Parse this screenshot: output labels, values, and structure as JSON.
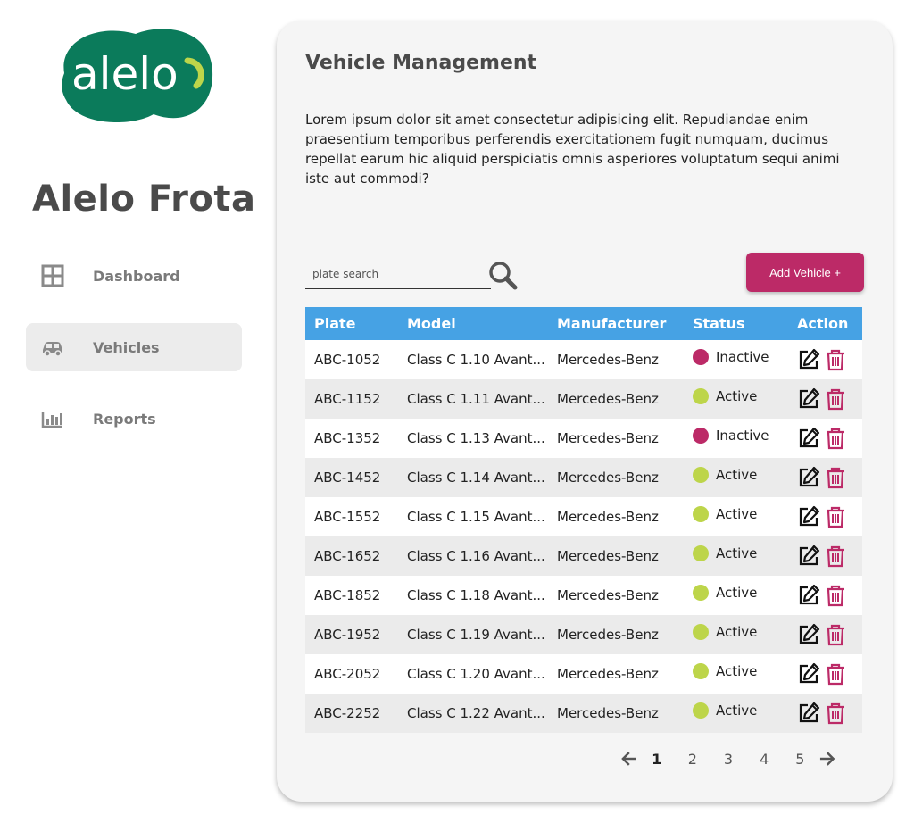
{
  "brand": {
    "logo_text": "alelo",
    "logo_color": "#0b7b5b",
    "logo_accent": "#bdd54a",
    "title": "Alelo Frota"
  },
  "nav": {
    "items": [
      {
        "label": "Dashboard",
        "icon": "grid-icon",
        "active": false
      },
      {
        "label": "Vehicles",
        "icon": "car-icon",
        "active": true
      },
      {
        "label": "Reports",
        "icon": "bar-chart-icon",
        "active": false
      }
    ]
  },
  "main": {
    "title": "Vehicle Management",
    "description": "Lorem ipsum dolor sit amet consectetur adipisicing elit. Repudiandae enim praesentium temporibus perferendis exercitationem fugit numquam, ducimus repellat earum hic aliquid perspiciatis omnis asperiores voluptatum sequi animi iste aut commodi?",
    "search": {
      "placeholder": "plate search",
      "value": "",
      "icon": "search-icon"
    },
    "add_button_label": "Add Vehicle +"
  },
  "table": {
    "columns": [
      "Plate",
      "Model",
      "Manufacturer",
      "Status",
      "Action"
    ],
    "rows": [
      {
        "plate": "ABC-1052",
        "model": "Class C 1.10 Avant...",
        "manufacturer": "Mercedes-Benz",
        "status": "Inactive"
      },
      {
        "plate": "ABC-1152",
        "model": "Class C 1.11 Avant...",
        "manufacturer": "Mercedes-Benz",
        "status": "Active"
      },
      {
        "plate": "ABC-1352",
        "model": "Class C 1.13 Avant...",
        "manufacturer": "Mercedes-Benz",
        "status": "Inactive"
      },
      {
        "plate": "ABC-1452",
        "model": "Class C 1.14 Avant...",
        "manufacturer": "Mercedes-Benz",
        "status": "Active"
      },
      {
        "plate": "ABC-1552",
        "model": "Class C 1.15 Avant...",
        "manufacturer": "Mercedes-Benz",
        "status": "Active"
      },
      {
        "plate": "ABC-1652",
        "model": "Class C 1.16 Avant...",
        "manufacturer": "Mercedes-Benz",
        "status": "Active"
      },
      {
        "plate": "ABC-1852",
        "model": "Class C 1.18 Avant...",
        "manufacturer": "Mercedes-Benz",
        "status": "Active"
      },
      {
        "plate": "ABC-1952",
        "model": "Class C 1.19 Avant...",
        "manufacturer": "Mercedes-Benz",
        "status": "Active"
      },
      {
        "plate": "ABC-2052",
        "model": "Class C 1.20 Avant...",
        "manufacturer": "Mercedes-Benz",
        "status": "Active"
      },
      {
        "plate": "ABC-2252",
        "model": "Class C 1.22 Avant...",
        "manufacturer": "Mercedes-Benz",
        "status": "Active"
      }
    ],
    "action_icons": [
      "edit-icon",
      "trash-icon"
    ]
  },
  "pagination": {
    "pages": [
      "1",
      "2",
      "3",
      "4",
      "5"
    ],
    "current": "1"
  },
  "colors": {
    "accent": "#bc2a67",
    "header": "#46a2e4",
    "active": "#bdd54a",
    "inactive": "#bc2a67",
    "card_bg": "#f5f5f5"
  }
}
